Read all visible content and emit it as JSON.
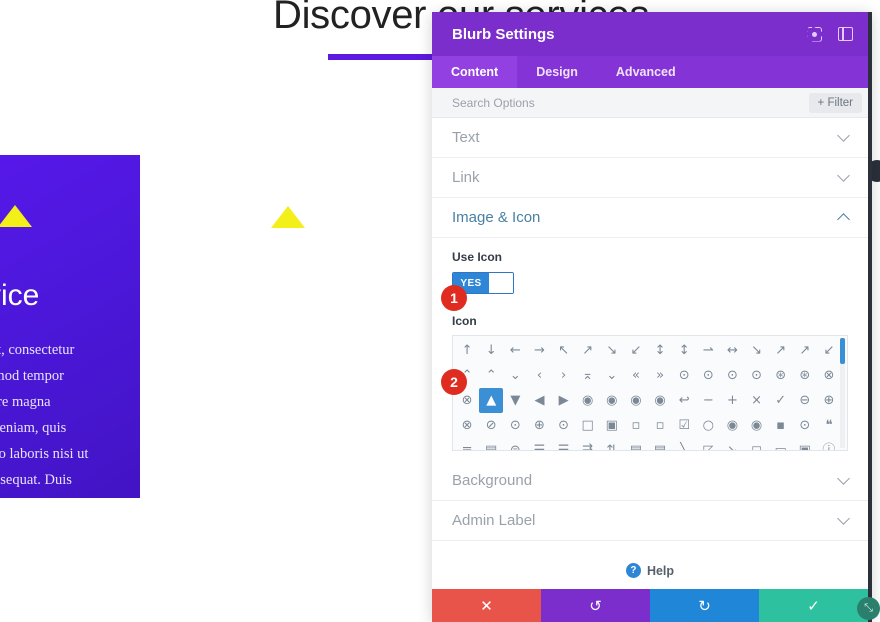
{
  "page": {
    "heading": "Discover our services",
    "card": {
      "icon": "triangle-up-icon",
      "title": "Our service",
      "body": "Lorem ipsum dolor sit amet, consectetur adipiscing elit, sed do eiusmod tempor incididunt ut labore et dolore magna aliqua. Ut enim ad minim veniam, quis nostrud exercitation ullamco laboris nisi ut aliquip ex ea commodo consequat. Duis"
    },
    "standalone_icon": "triangle-up-icon"
  },
  "modal": {
    "title": "Blurb Settings",
    "header_icons": [
      {
        "name": "focus-target-icon",
        "label": ""
      },
      {
        "name": "panel-layout-icon",
        "label": ""
      }
    ],
    "tabs": [
      {
        "label": "Content",
        "active": true
      },
      {
        "label": "Design",
        "active": false
      },
      {
        "label": "Advanced",
        "active": false
      }
    ],
    "search": {
      "placeholder": "Search Options",
      "value": ""
    },
    "filter_label": "+ Filter",
    "sections": [
      {
        "label": "Text",
        "open": false
      },
      {
        "label": "Link",
        "open": false
      },
      {
        "label": "Image & Icon",
        "open": true
      },
      {
        "label": "Background",
        "open": false
      },
      {
        "label": "Admin Label",
        "open": false
      }
    ],
    "use_icon": {
      "label": "Use Icon",
      "toggle_value": "YES"
    },
    "icon_picker": {
      "label": "Icon",
      "selected_index": 33,
      "glyphs": [
        "↑",
        "↓",
        "←",
        "→",
        "↖",
        "↗",
        "↘",
        "↙",
        "↕",
        "↕",
        "⇀",
        "↔",
        "↘",
        "↗",
        "↗",
        "↙",
        "⌃",
        "⌃",
        "⌄",
        "‹",
        "›",
        "⌅",
        "⌄",
        "«",
        "»",
        "⊙",
        "⊙",
        "⊙",
        "⊙",
        "⊛",
        "⊛",
        "⊗",
        "⊗",
        "▲",
        "▼",
        "◀",
        "▶",
        "◉",
        "◉",
        "◉",
        "◉",
        "↩",
        "−",
        "+",
        "×",
        "✓",
        "⊖",
        "⊕",
        "⊗",
        "⊘",
        "⊙",
        "⊕",
        "⊙",
        "□",
        "▣",
        "▫",
        "▫",
        "☑",
        "○",
        "◉",
        "◉",
        "▪",
        "⊙",
        "❝",
        "≡",
        "▤",
        "⊜",
        "☰",
        "☰",
        "⇶",
        "⇅",
        "▤",
        "▤",
        "╲",
        "◸",
        "↘",
        "◻",
        "▭",
        "▣",
        "ⓘ"
      ]
    },
    "help_label": "Help",
    "actions": [
      {
        "name": "cancel-button",
        "glyph": "✕"
      },
      {
        "name": "undo-button",
        "glyph": "↺"
      },
      {
        "name": "redo-button",
        "glyph": "↻"
      },
      {
        "name": "save-button",
        "glyph": "✓"
      }
    ],
    "resize_glyph": "⤡"
  },
  "badges": [
    {
      "number": "1"
    },
    {
      "number": "2"
    }
  ],
  "colors": {
    "modal_header": "#7b2ecc",
    "tab_bar": "#8434d6",
    "toggle_on": "#2f86d6",
    "badge": "#e02b20",
    "card_purple": "#5a19ef",
    "accent_yellow": "#f2ef19",
    "cancel": "#e8534a",
    "undo": "#7b2ecc",
    "redo": "#1f86d8",
    "save": "#2dc1a0"
  }
}
